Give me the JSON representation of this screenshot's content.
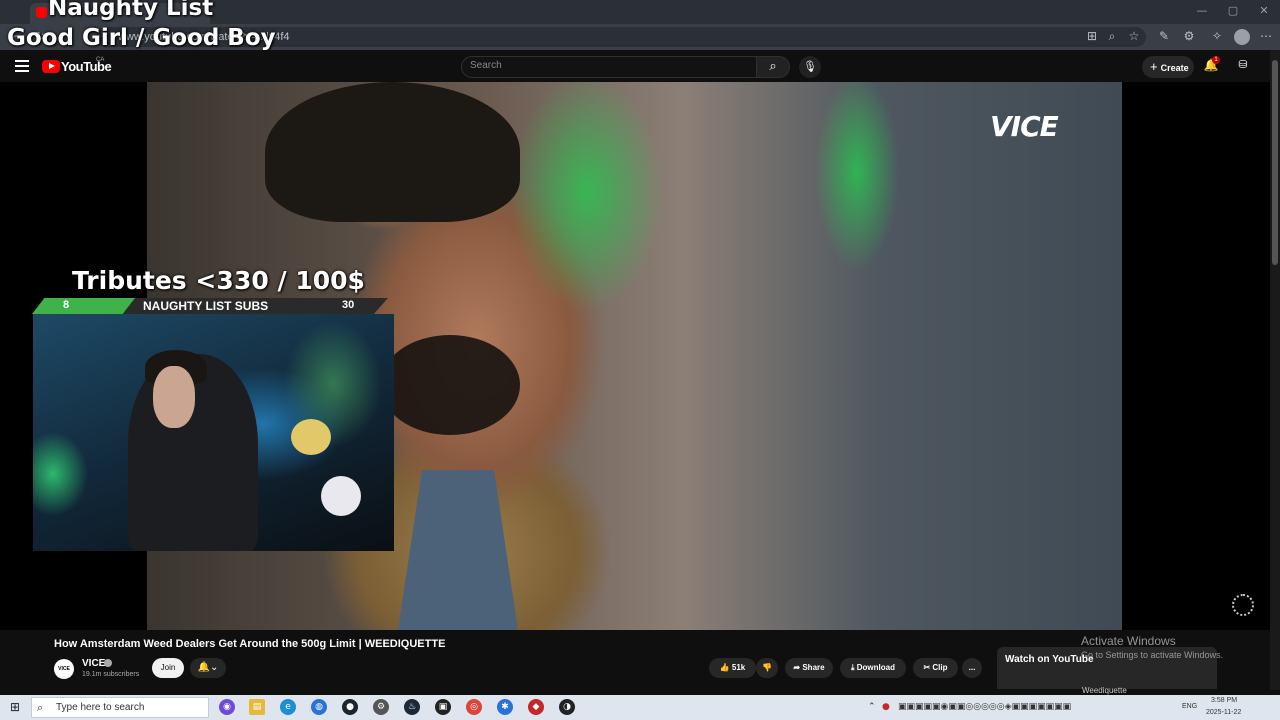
{
  "overlay": {
    "title": "Naughty List",
    "subtitle": "Good Girl / Good Boy",
    "tributes_label": "Tributes <3",
    "tributes_amount": "30 / 100$",
    "subs_label": "NAUGHTY LIST SUBS",
    "subs_current": "8",
    "subs_goal": "30",
    "subs_progress_fraction": 0.27
  },
  "browser": {
    "url": "www.youtube.com/watch?v=...lx4f4",
    "window_controls": [
      "—",
      "▢",
      "✕"
    ]
  },
  "youtube": {
    "logo_text": "YouTube",
    "country_code": "CA",
    "search_placeholder": "Search",
    "create_label": "Create",
    "notification_count": "1",
    "watermark": "VICE",
    "video": {
      "title": "How Amsterdam Weed Dealers Get Around the 500g Limit | WEEDIQUETTE",
      "channel": "VICE",
      "channel_avatar_text": "VICE",
      "subscribers": "19.1m subscribers",
      "join_label": "Join",
      "likes": "51k",
      "share_label": "Share",
      "download_label": "Download",
      "clip_label": "Clip",
      "more_label": "..."
    },
    "watch_on_youtube": "Watch on YouTube",
    "next_video_title": "Weediquette"
  },
  "windows": {
    "activate_title": "Activate Windows",
    "activate_sub": "Go to Settings to activate Windows.",
    "taskbar_search": "Type here to search",
    "language": "ENG",
    "time": "3:58 PM",
    "date": "2025-11-22"
  },
  "colors": {
    "accent_youtube_red": "#ff0000",
    "progress_green": "#3fb24a",
    "taskbar": "#dfe5ee"
  }
}
